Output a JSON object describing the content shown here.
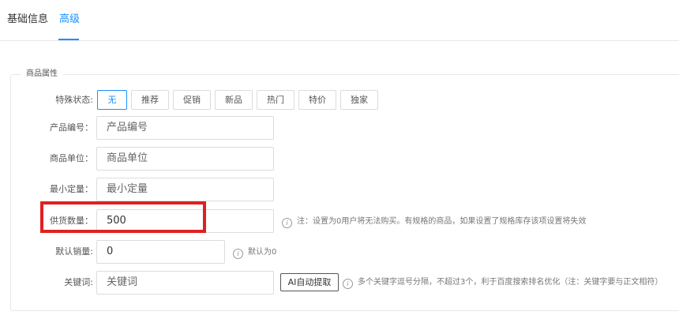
{
  "tabs": [
    {
      "label": "基础信息",
      "active": false
    },
    {
      "label": "高级",
      "active": true
    }
  ],
  "section": {
    "legend": "商品属性"
  },
  "special_status": {
    "label": "特殊状态:",
    "options": [
      "无",
      "推荐",
      "促销",
      "新品",
      "热门",
      "特价",
      "独家"
    ],
    "selected": "无"
  },
  "product_code": {
    "label": "产品编号：",
    "placeholder": "产品编号",
    "value": ""
  },
  "product_unit": {
    "label": "商品单位：",
    "placeholder": "商品单位",
    "value": ""
  },
  "min_order": {
    "label": "最小定量：",
    "placeholder": "最小定量",
    "value": ""
  },
  "supply_qty": {
    "label": "供货数量：",
    "value": "500",
    "hint": "注：设置为0用户将无法购买。有规格的商品，如果设置了规格库存该项设置将失效"
  },
  "default_sales": {
    "label": "默认销量:",
    "value": "0",
    "hint": "默认为0"
  },
  "keywords": {
    "label": "关键词:",
    "placeholder": "关键词",
    "ai_button": "AI自动提取",
    "hint": "多个关键字逗号分隔，不超过3个，利于百度搜索排名优化（注：关键字要与正文相符）"
  },
  "colors": {
    "accent": "#1890ff",
    "highlight": "#e02020"
  },
  "icons": {
    "info": "info-circle-icon"
  }
}
